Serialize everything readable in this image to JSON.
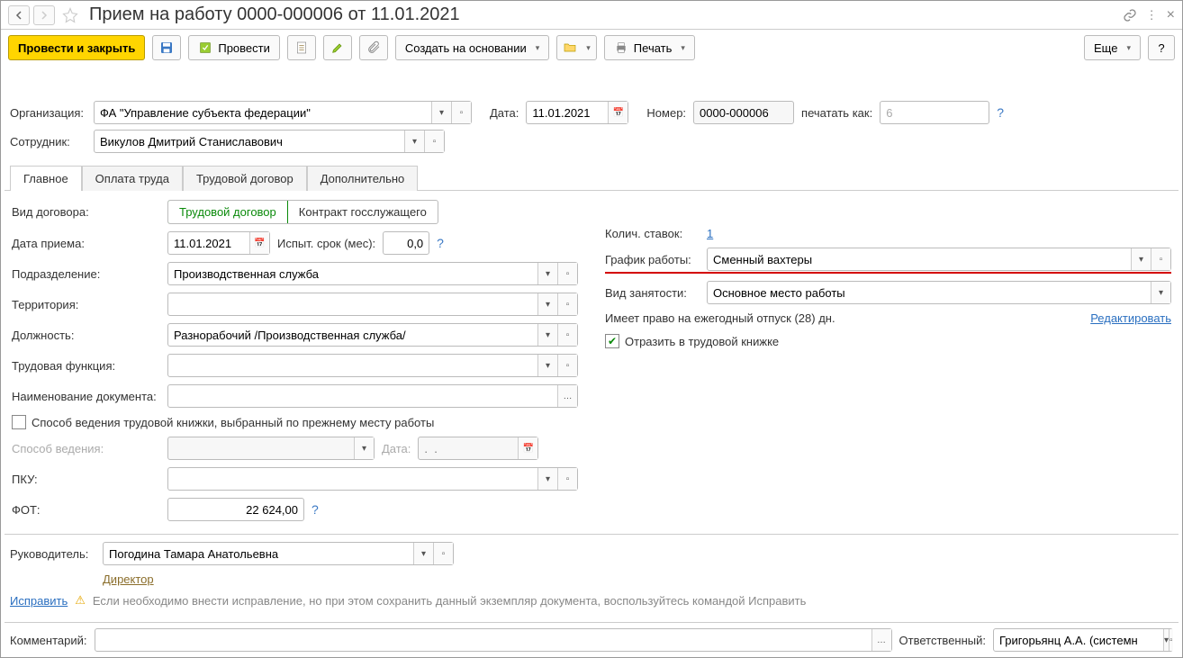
{
  "title": "Прием на работу 0000-000006 от 11.01.2021",
  "toolbar": {
    "post_close": "Провести и закрыть",
    "post": "Провести",
    "create_basis": "Создать на основании",
    "print": "Печать",
    "more": "Еще",
    "help": "?"
  },
  "header": {
    "org_label": "Организация:",
    "org_value": "ФА \"Управление субъекта федерации\"",
    "date_label": "Дата:",
    "date_value": "11.01.2021",
    "number_label": "Номер:",
    "number_value": "0000-000006",
    "print_as_label": "печатать как:",
    "print_as_value": "6",
    "employee_label": "Сотрудник:",
    "employee_value": "Викулов Дмитрий Станиславович"
  },
  "tabs": [
    "Главное",
    "Оплата труда",
    "Трудовой договор",
    "Дополнительно"
  ],
  "main": {
    "contract_type_label": "Вид договора:",
    "contract_type_options": [
      "Трудовой договор",
      "Контракт госслужащего"
    ],
    "start_date_label": "Дата приема:",
    "start_date_value": "11.01.2021",
    "trial_label": "Испыт. срок (мес):",
    "trial_value": "0,0",
    "department_label": "Подразделение:",
    "department_value": "Производственная служба",
    "territory_label": "Территория:",
    "position_label": "Должность:",
    "position_value": "Разнорабочий /Производственная служба/",
    "labor_function_label": "Трудовая функция:",
    "doc_name_label": "Наименование документа:",
    "prev_workbook_label": "Способ ведения трудовой книжки, выбранный по прежнему месту работы",
    "method_label": "Способ ведения:",
    "method_date_label": "Дата:",
    "method_date_placeholder": ".  .",
    "pku_label": "ПКУ:",
    "fot_label": "ФОТ:",
    "fot_value": "22 624,00",
    "rates_label": "Колич. ставок:",
    "rates_value": "1",
    "schedule_label": "График работы:",
    "schedule_value": "Сменный вахтеры",
    "employment_type_label": "Вид занятости:",
    "employment_type_value": "Основное место работы",
    "vacation_label": "Имеет право на ежегодный отпуск (28) дн.",
    "edit_link": "Редактировать",
    "reflect_label": "Отразить в трудовой книжке"
  },
  "manager": {
    "label": "Руководитель:",
    "value": "Погодина Тамара Анатольевна",
    "position": "Директор"
  },
  "correction": {
    "link": "Исправить",
    "note": "Если необходимо внести исправление, но при этом сохранить данный экземпляр документа, воспользуйтесь командой Исправить"
  },
  "footer": {
    "comment_label": "Комментарий:",
    "responsible_label": "Ответственный:",
    "responsible_value": "Григорьянц А.А. (системн"
  }
}
